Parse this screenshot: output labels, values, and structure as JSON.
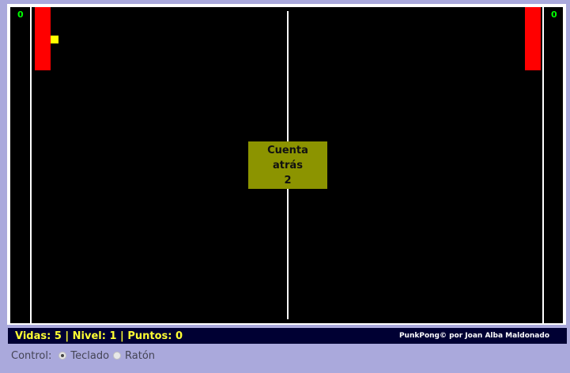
{
  "game": {
    "score_left": "0",
    "score_right": "0",
    "countdown": {
      "line1": "Cuenta",
      "line2": "atrás",
      "value": "2"
    },
    "colors": {
      "field": "#000000",
      "paddle": "#ff0000",
      "ball": "#ffff00",
      "score": "#00ff00",
      "countdown_box": "#8c9400"
    }
  },
  "status_bar": {
    "stats": "Vidas: 5 | Nivel: 1 | Puntos: 0",
    "credits": "PunkPong© por Joan Alba Maldonado"
  },
  "controls": {
    "label": "Control:",
    "options": [
      {
        "label": "Teclado",
        "checked": true
      },
      {
        "label": "Ratón",
        "checked": false
      }
    ]
  }
}
